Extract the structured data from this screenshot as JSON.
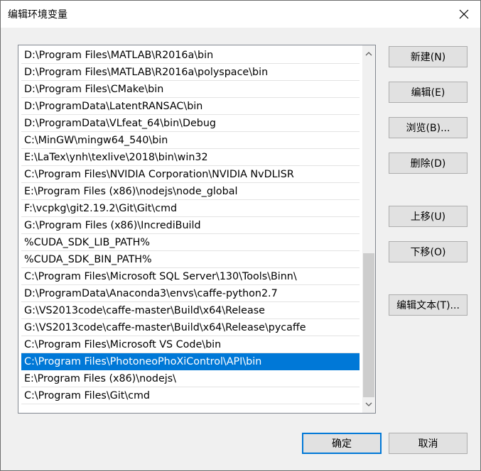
{
  "window": {
    "title": "编辑环境变量"
  },
  "paths": [
    "D:\\Program Files\\MATLAB\\R2016a\\bin",
    "D:\\Program Files\\MATLAB\\R2016a\\polyspace\\bin",
    "D:\\Program Files\\CMake\\bin",
    "D:\\ProgramData\\LatentRANSAC\\bin",
    "D:\\ProgramData\\VLfeat_64\\bin\\Debug",
    "C:\\MinGW\\mingw64_540\\bin",
    "E:\\LaTex\\ynh\\texlive\\2018\\bin\\win32",
    "C:\\Program Files\\NVIDIA Corporation\\NVIDIA NvDLISR",
    "E:\\Program Files (x86)\\nodejs\\node_global",
    "F:\\vcpkg\\git2.19.2\\Git\\Git\\cmd",
    "G:\\Program Files (x86)\\IncrediBuild",
    "%CUDA_SDK_LIB_PATH%",
    "%CUDA_SDK_BIN_PATH%",
    "C:\\Program Files\\Microsoft SQL Server\\130\\Tools\\Binn\\",
    "D:\\ProgramData\\Anaconda3\\envs\\caffe-python2.7",
    "G:\\VS2013code\\caffe-master\\Build\\x64\\Release",
    "G:\\VS2013code\\caffe-master\\Build\\x64\\Release\\pycaffe",
    "C:\\Program Files\\Microsoft VS Code\\bin",
    "C:\\Program Files\\PhotoneoPhoXiControl\\API\\bin",
    "E:\\Program Files (x86)\\nodejs\\",
    "C:\\Program Files\\Git\\cmd"
  ],
  "selected_index": 18,
  "buttons": {
    "new": "新建(N)",
    "edit": "编辑(E)",
    "browse": "浏览(B)...",
    "delete": "删除(D)",
    "move_up": "上移(U)",
    "move_down": "下移(O)",
    "edit_text": "编辑文本(T)...",
    "ok": "确定",
    "cancel": "取消"
  },
  "colors": {
    "selection": "#0078d7"
  }
}
